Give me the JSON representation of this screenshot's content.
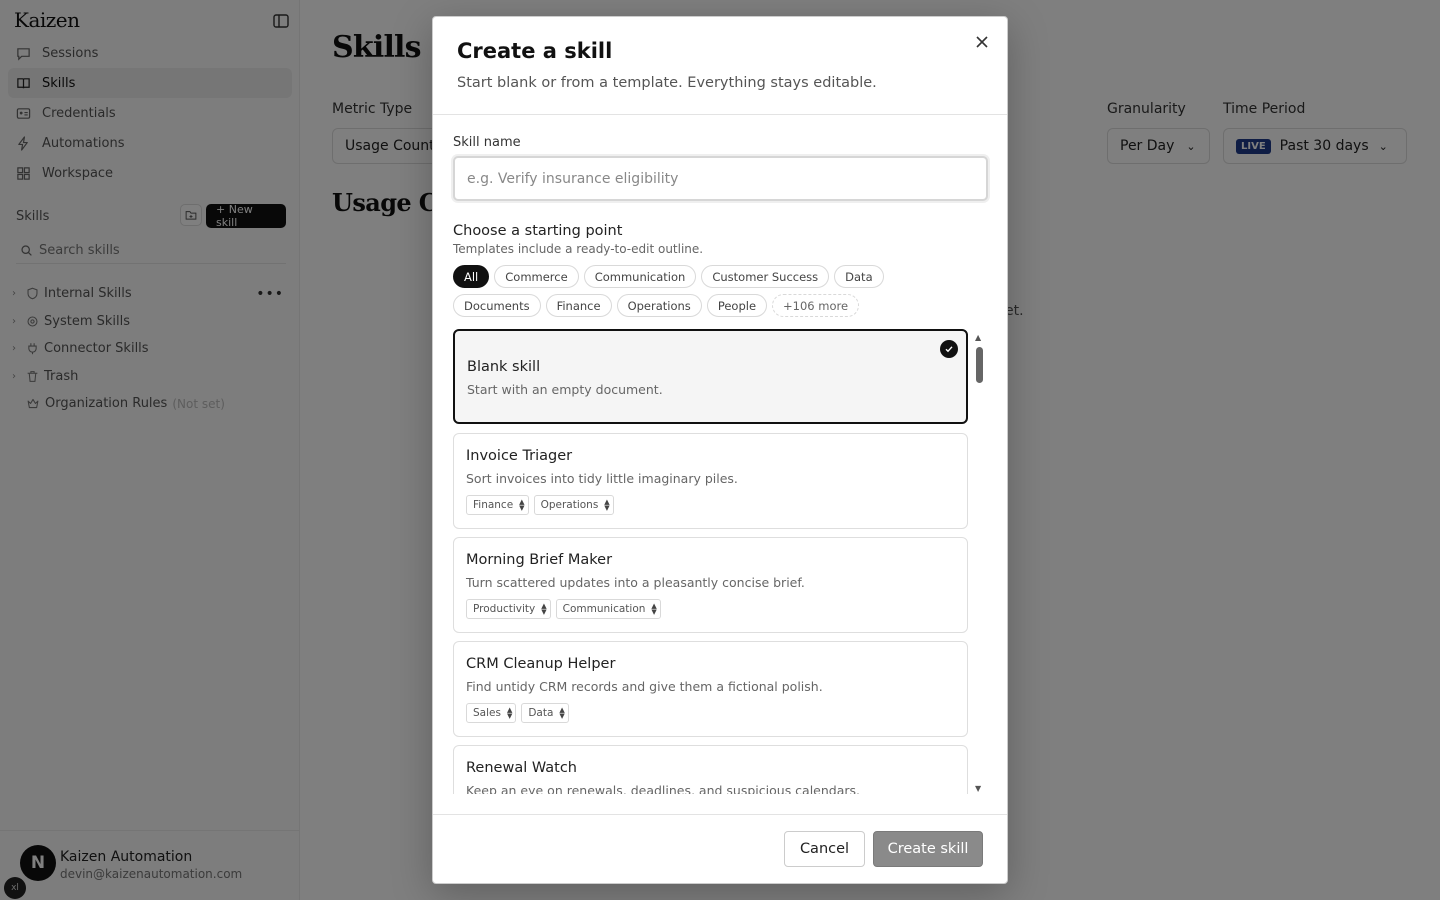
{
  "app": {
    "brand": "Kaizen",
    "nav": [
      {
        "label": "Sessions",
        "icon": "chat-icon"
      },
      {
        "label": "Skills",
        "icon": "book-icon",
        "active": true
      },
      {
        "label": "Credentials",
        "icon": "id-card-icon"
      },
      {
        "label": "Automations",
        "icon": "bolt-icon"
      },
      {
        "label": "Workspace",
        "icon": "grid-icon"
      }
    ],
    "skills_section": {
      "heading": "Skills",
      "new_skill_label": "+ New skill",
      "search_placeholder": "Search skills",
      "tree": [
        {
          "label": "Internal Skills",
          "icon": "shield-icon"
        },
        {
          "label": "System Skills",
          "icon": "gear-icon"
        },
        {
          "label": "Connector Skills",
          "icon": "plug-icon"
        },
        {
          "label": "Trash",
          "icon": "trash-icon"
        }
      ],
      "org_rules": {
        "label": "Organization Rules",
        "status": "(Not set)"
      }
    },
    "user": {
      "initial": "N",
      "name": "Kaizen Automation",
      "email": "devin@kaizenautomation.com",
      "corner_badge": "xl"
    }
  },
  "main": {
    "title": "Skills",
    "metric_type_label": "Metric Type",
    "metric_type_value": "Usage Count",
    "granularity_label": "Granularity",
    "granularity_value": "Per Day",
    "time_period_label": "Time Period",
    "live_badge": "LIVE",
    "time_period_value": "Past 30 days",
    "section_title": "Usage Count",
    "empty_tail": "et."
  },
  "modal": {
    "title": "Create a skill",
    "subtitle": "Start blank or from a template. Everything stays editable.",
    "field_label": "Skill name",
    "name_placeholder": "e.g. Verify insurance eligibility",
    "start_title": "Choose a starting point",
    "start_subtitle": "Templates include a ready-to-edit outline.",
    "chips": [
      "All",
      "Commerce",
      "Communication",
      "Customer Success",
      "Data",
      "Documents",
      "Finance",
      "Operations",
      "People",
      "+106 more"
    ],
    "selected_chip": "All",
    "templates": [
      {
        "title": "Blank skill",
        "desc": "Start with an empty document.",
        "tags": [],
        "selected": true
      },
      {
        "title": "Invoice Triager",
        "desc": "Sort invoices into tidy little imaginary piles.",
        "tags": [
          "Finance",
          "Operations"
        ]
      },
      {
        "title": "Morning Brief Maker",
        "desc": "Turn scattered updates into a pleasantly concise brief.",
        "tags": [
          "Productivity",
          "Communication"
        ]
      },
      {
        "title": "CRM Cleanup Helper",
        "desc": "Find untidy CRM records and give them a fictional polish.",
        "tags": [
          "Sales",
          "Data"
        ]
      },
      {
        "title": "Renewal Watch",
        "desc": "Keep an eye on renewals, deadlines, and suspicious calendars.",
        "tags": []
      }
    ],
    "cancel_label": "Cancel",
    "create_label": "Create skill"
  }
}
